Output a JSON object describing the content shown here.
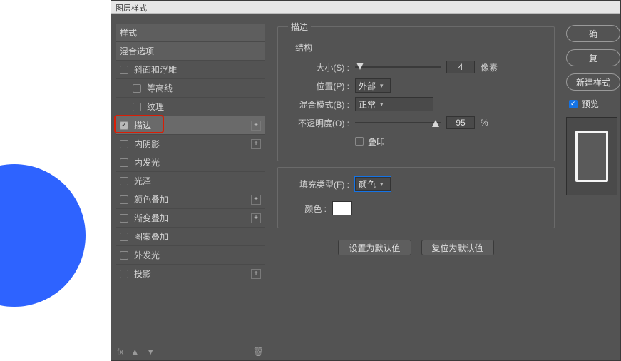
{
  "titlebar": "图层样式",
  "styles": {
    "header": "样式",
    "blend_options": "混合选项",
    "items": [
      {
        "label": "斜面和浮雕",
        "checked": false,
        "plus": false,
        "sub": false
      },
      {
        "label": "等高线",
        "checked": false,
        "plus": false,
        "sub": true
      },
      {
        "label": "纹理",
        "checked": false,
        "plus": false,
        "sub": true
      },
      {
        "label": "描边",
        "checked": true,
        "plus": true,
        "sub": false,
        "selected": true,
        "highlight": true
      },
      {
        "label": "内阴影",
        "checked": false,
        "plus": true,
        "sub": false
      },
      {
        "label": "内发光",
        "checked": false,
        "plus": false,
        "sub": false
      },
      {
        "label": "光泽",
        "checked": false,
        "plus": false,
        "sub": false
      },
      {
        "label": "颜色叠加",
        "checked": false,
        "plus": true,
        "sub": false
      },
      {
        "label": "渐变叠加",
        "checked": false,
        "plus": true,
        "sub": false
      },
      {
        "label": "图案叠加",
        "checked": false,
        "plus": false,
        "sub": false
      },
      {
        "label": "外发光",
        "checked": false,
        "plus": false,
        "sub": false
      },
      {
        "label": "投影",
        "checked": false,
        "plus": true,
        "sub": false
      }
    ],
    "footer": {
      "fx": "fx",
      "up": "▲",
      "down": "▼",
      "trash": "🗑"
    }
  },
  "stroke": {
    "group_label": "描边",
    "structure_label": "结构",
    "size_label": "大小(S) :",
    "size_value": "4",
    "size_unit": "像素",
    "position_label": "位置(P) :",
    "position_value": "外部",
    "blend_mode_label": "混合模式(B) :",
    "blend_mode_value": "正常",
    "opacity_label": "不透明度(O) :",
    "opacity_value": "95",
    "opacity_unit": "%",
    "overprint_label": "叠印",
    "fill_type_label": "填充类型(F) :",
    "fill_type_value": "颜色",
    "color_label": "颜色 :",
    "make_default": "设置为默认值",
    "reset_default": "复位为默认值"
  },
  "right": {
    "ok": "确",
    "cancel": "复",
    "new_style": "新建样式",
    "preview_label": "预览"
  }
}
